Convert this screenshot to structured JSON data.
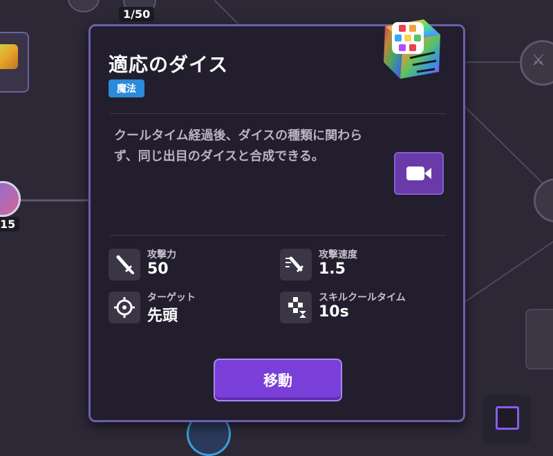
{
  "background": {
    "top_node_badge": "1/50",
    "left_node_badge": "15"
  },
  "panel": {
    "title": "適応のダイス",
    "tag": "魔法",
    "description": "クールタイム経過後、ダイスの種類に関わらず、同じ出目のダイスと合成できる。",
    "stats": {
      "attack": {
        "label": "攻撃力",
        "value": "50",
        "icon": "sword-icon"
      },
      "attack_speed": {
        "label": "攻撃速度",
        "value": "1.5",
        "icon": "fast-sword-icon"
      },
      "target": {
        "label": "ターゲット",
        "value": "先頭",
        "icon": "crosshair-icon"
      },
      "cooldown": {
        "label": "スキルクールタイム",
        "value": "10s",
        "icon": "hourglass-dice-icon"
      }
    },
    "move_button": "移動"
  },
  "colors": {
    "panel_bg": "#221e2d",
    "panel_border": "#6d5fb0",
    "tag_bg": "#2b8ad9",
    "button_bg": "#7a3fd8",
    "video_button_bg": "#6a3aa8"
  }
}
